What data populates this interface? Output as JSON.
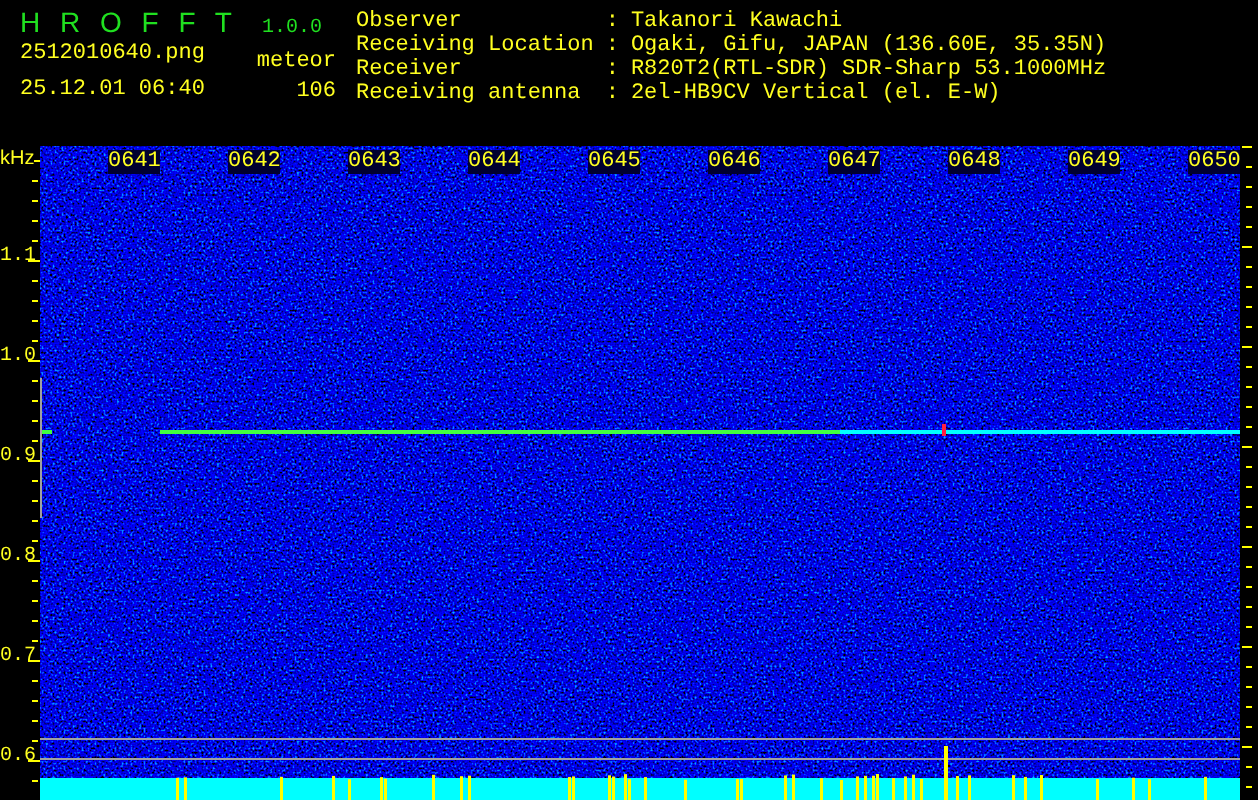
{
  "app": {
    "title": "H R O F F T",
    "version": "1.0.0"
  },
  "capture": {
    "filename": "2512010640.png",
    "datetime": "25.12.01 06:40",
    "mode": "meteor",
    "count": "106"
  },
  "station": [
    {
      "label": "Observer",
      "separator": ":",
      "value": "Takanori Kawachi"
    },
    {
      "label": "Receiving Location",
      "separator": ":",
      "value": "Ogaki, Gifu, JAPAN (136.60E, 35.35N)"
    },
    {
      "label": "Receiver",
      "separator": ":",
      "value": "R820T2(RTL-SDR) SDR-Sharp 53.1000MHz"
    },
    {
      "label": "Receiving antenna",
      "separator": ":",
      "value": "2el-HB9CV Vertical (el. E-W)"
    }
  ],
  "spectrogram": {
    "frequency_unit": "kHz",
    "time_labels": [
      "0641",
      "0642",
      "0643",
      "0644",
      "0645",
      "0646",
      "0647",
      "0648",
      "0649",
      "0650"
    ],
    "frequency_labels": [
      "1.1",
      "1.0",
      "0.9",
      "0.8",
      "0.7",
      "0.6"
    ]
  }
}
